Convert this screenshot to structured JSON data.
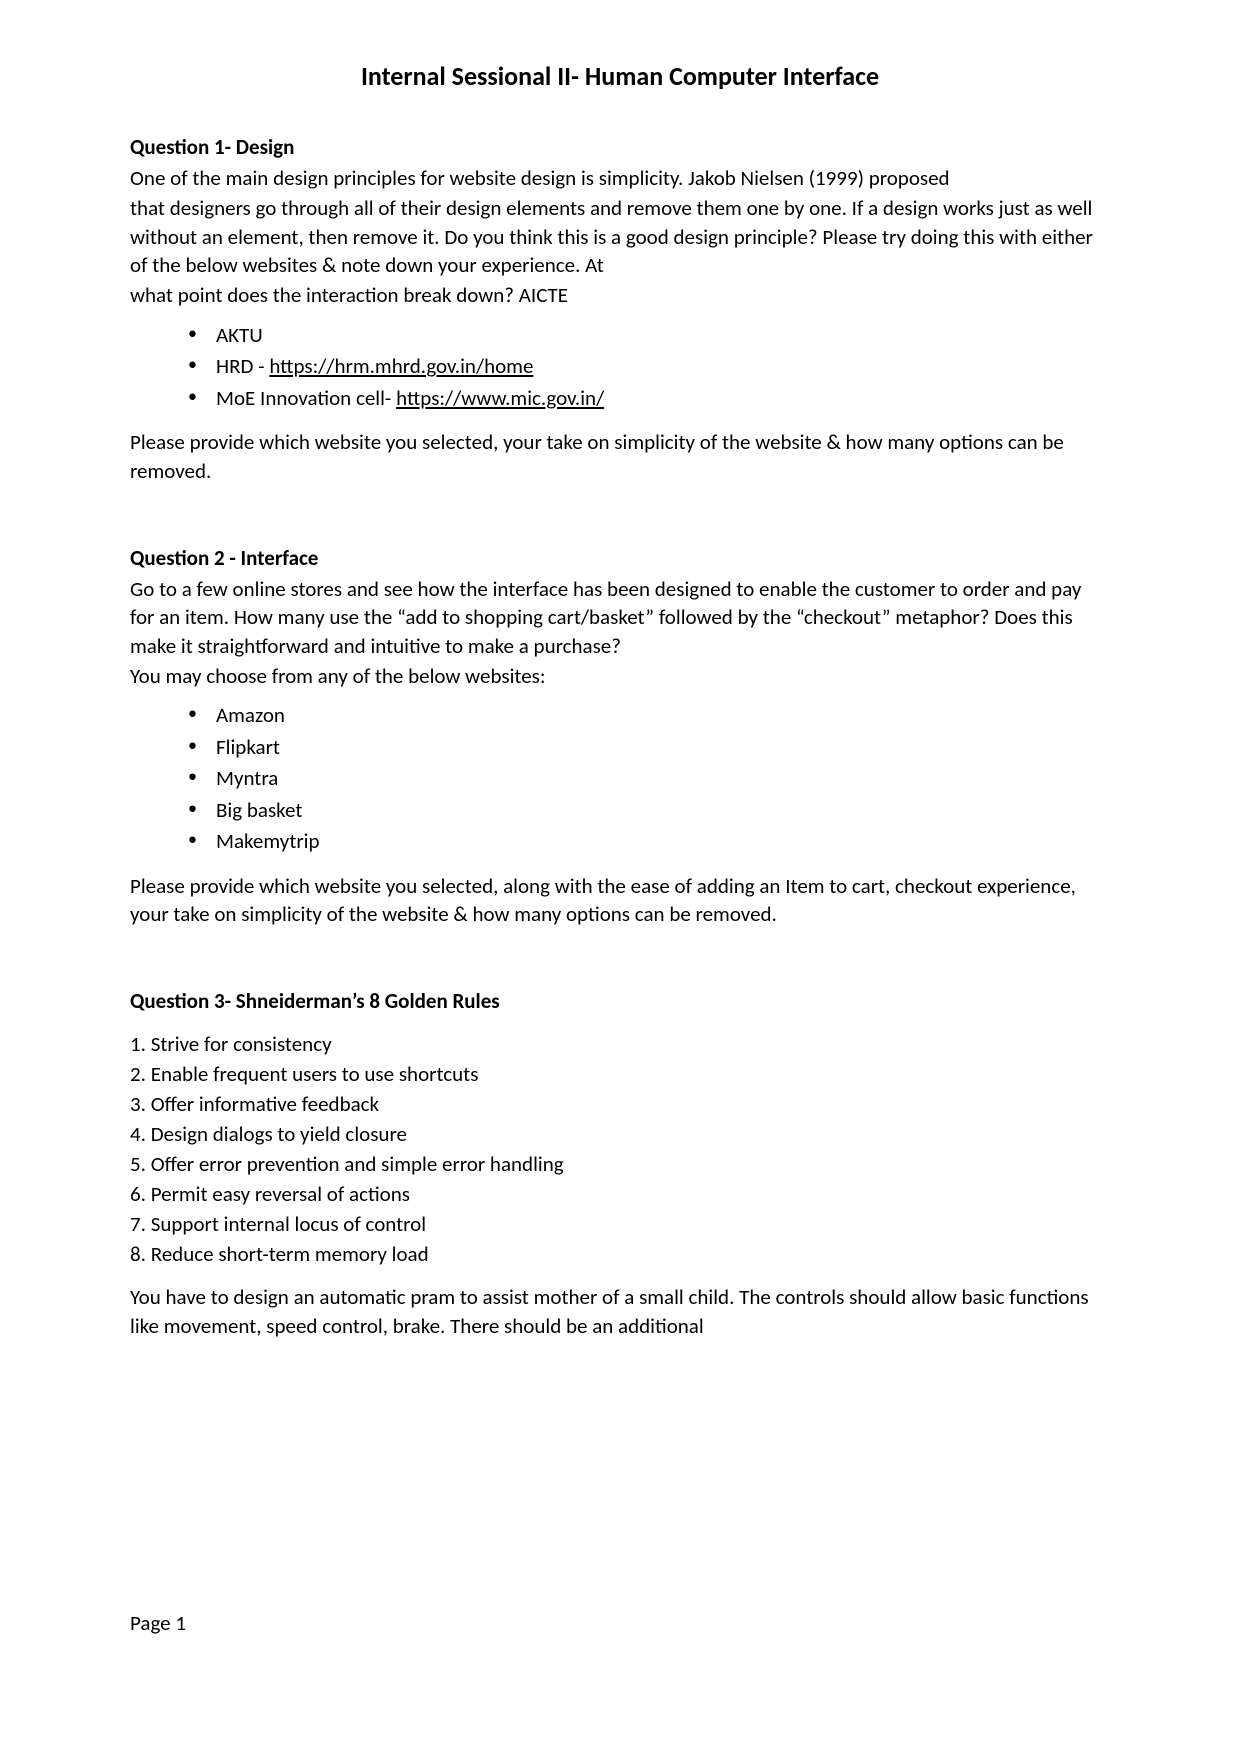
{
  "title": "Internal Sessional II- Human Computer Interface",
  "q1": {
    "heading": "Question 1- Design",
    "p1": "One of the main design principles for website design is simplicity. Jakob Nielsen (1999) proposed",
    "p2": "that designers go through all of their design elements and remove them one by one. If a design works just as well without an element, then remove it. Do you think this is a good design principle? Please try doing this with either of the below websites & note down your experience. At",
    "p3": "what point does the interaction break down? AICTE",
    "bullets": [
      {
        "text": "AKTU"
      },
      {
        "prefix": "HRD - ",
        "link": "https://hrm.mhrd.gov.in/home"
      },
      {
        "prefix": "MoE Innovation cell- ",
        "link": "https://www.mic.gov.in/"
      }
    ],
    "closing": "Please provide which website you selected, your take on simplicity of the website & how many options can be removed."
  },
  "q2": {
    "heading": "Question 2 - Interface",
    "p1": "Go to a few online stores and see how the interface has been designed to enable the customer to order and pay for an item. How many use the “add to shopping cart/basket” followed by the “checkout” metaphor? Does this make it straightforward and intuitive to make a purchase?",
    "p2": "You may choose from any of the below websites:",
    "bullets": [
      "Amazon",
      "Flipkart",
      "Myntra",
      "Big basket",
      "Makemytrip"
    ],
    "closing": "Please provide which website you selected, along with the ease of adding an Item to cart, checkout experience, your take on simplicity of the website & how many options can be removed."
  },
  "q3": {
    "heading": "Question 3- Shneiderman’s 8 Golden Rules",
    "rules": [
      "1. Strive for consistency",
      "2. Enable frequent users to use shortcuts",
      "3. Offer informative feedback",
      "4. Design dialogs to yield closure",
      "5. Offer error prevention and simple error handling",
      "6. Permit easy reversal of actions",
      "7. Support internal locus of control",
      "8. Reduce short-term memory load"
    ],
    "closing": "You have to design an automatic pram to assist mother of a small child. The controls should allow basic functions like movement, speed control, brake. There should be an additional"
  },
  "footer": "Page 1"
}
